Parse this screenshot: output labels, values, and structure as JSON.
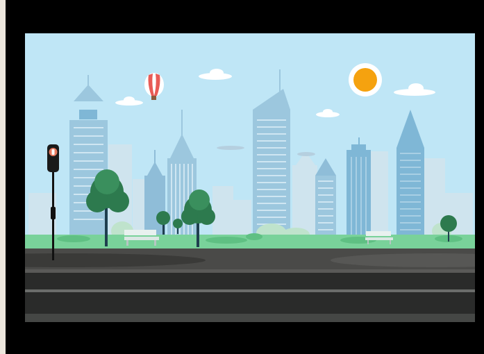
{
  "game": {
    "mode": "side-scrolling-scene",
    "elements": [
      "hot-air-balloon",
      "sun",
      "clouds",
      "city-skyline",
      "trees",
      "benches",
      "traffic-light",
      "road"
    ]
  },
  "colors": {
    "sky": "#bfe6f6",
    "sun": "#f5a20f",
    "grass": "#79d29a",
    "road": "#2a2b2a",
    "building": "#7fb7d6",
    "tree": "#2d7a4e",
    "balloon_stripe": "#e85b56",
    "frame": "#000000"
  }
}
